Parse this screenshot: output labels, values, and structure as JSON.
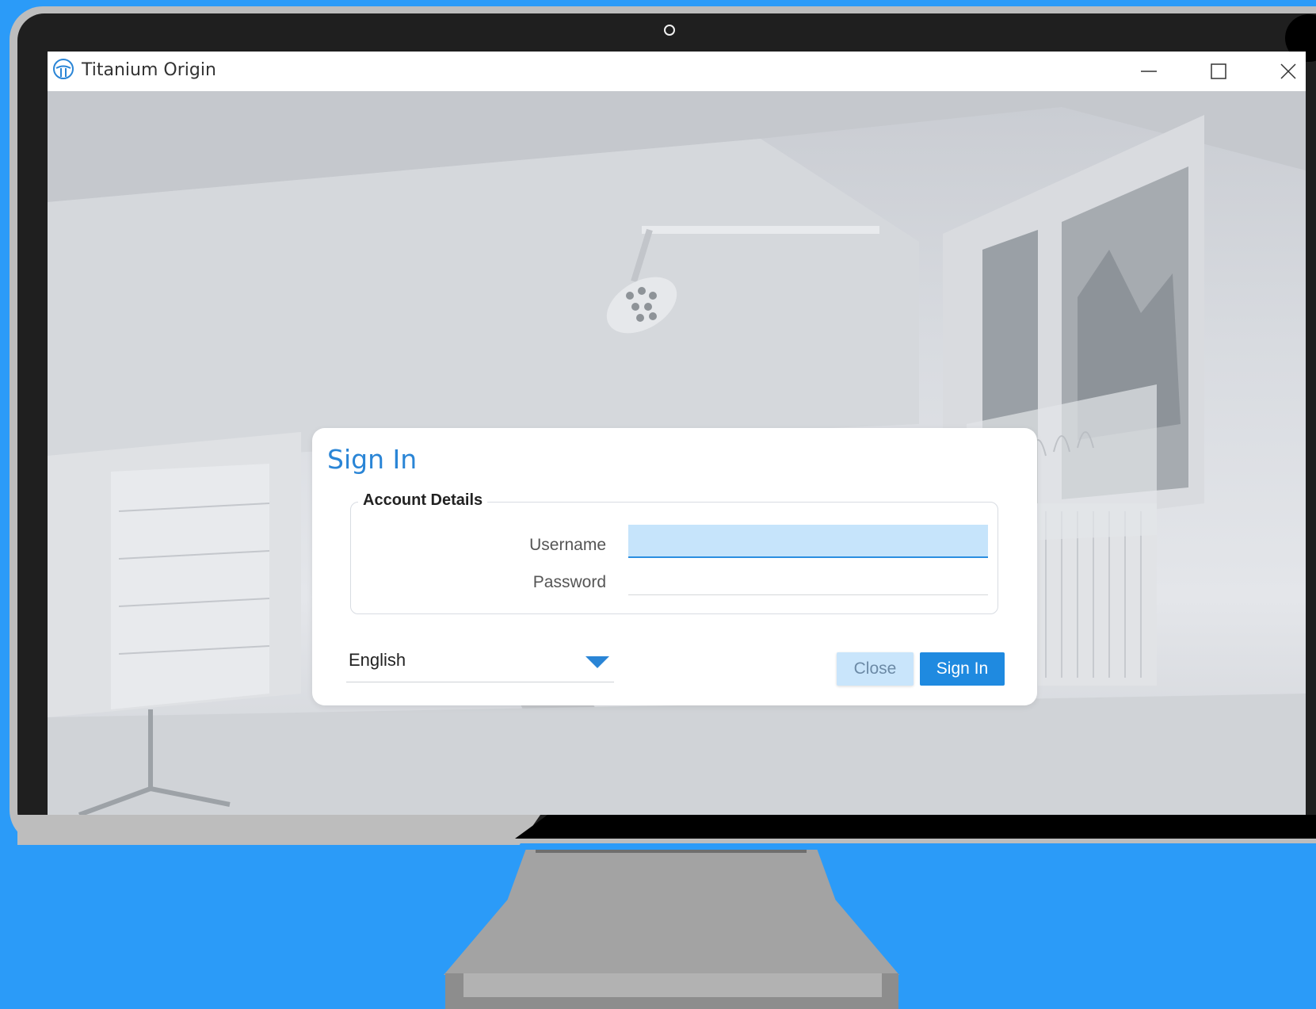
{
  "window": {
    "title": "Titanium Origin",
    "controls": {
      "minimize_icon": "minimize-icon",
      "maximize_icon": "maximize-icon",
      "close_icon": "close-icon"
    }
  },
  "dialog": {
    "title": "Sign In",
    "section_title": "Account Details",
    "username": {
      "label": "Username",
      "value": ""
    },
    "password": {
      "label": "Password",
      "value": ""
    },
    "language": {
      "selected": "English"
    },
    "buttons": {
      "close": "Close",
      "sign_in": "Sign In"
    }
  },
  "colors": {
    "accent": "#2a85d6",
    "primary_button": "#1f8ae0",
    "secondary_button": "#c9e5fb",
    "focus_field": "#c6e4fb",
    "backdrop": "#2b9bf8"
  }
}
